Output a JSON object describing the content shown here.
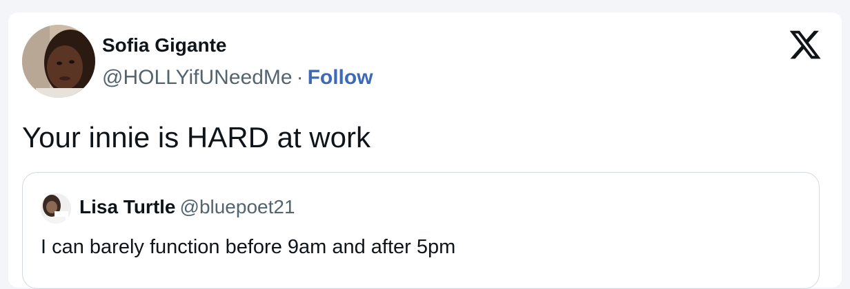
{
  "tweet": {
    "author_name": "Sofia Gigante",
    "author_handle": "@HOLLYifUNeedMe",
    "separator": "·",
    "follow_label": "Follow",
    "text": "Your innie is HARD at work",
    "brand_icon": "x-logo-icon"
  },
  "quoted_tweet": {
    "author_name": "Lisa Turtle",
    "author_handle": "@bluepoet21",
    "text": "I can barely function before 9am and after 5pm"
  },
  "colors": {
    "background": "#f3f5f8",
    "card": "#ffffff",
    "text_primary": "#0f1419",
    "text_secondary": "#536471",
    "link": "#3d69b8",
    "border": "#cfd9de"
  }
}
